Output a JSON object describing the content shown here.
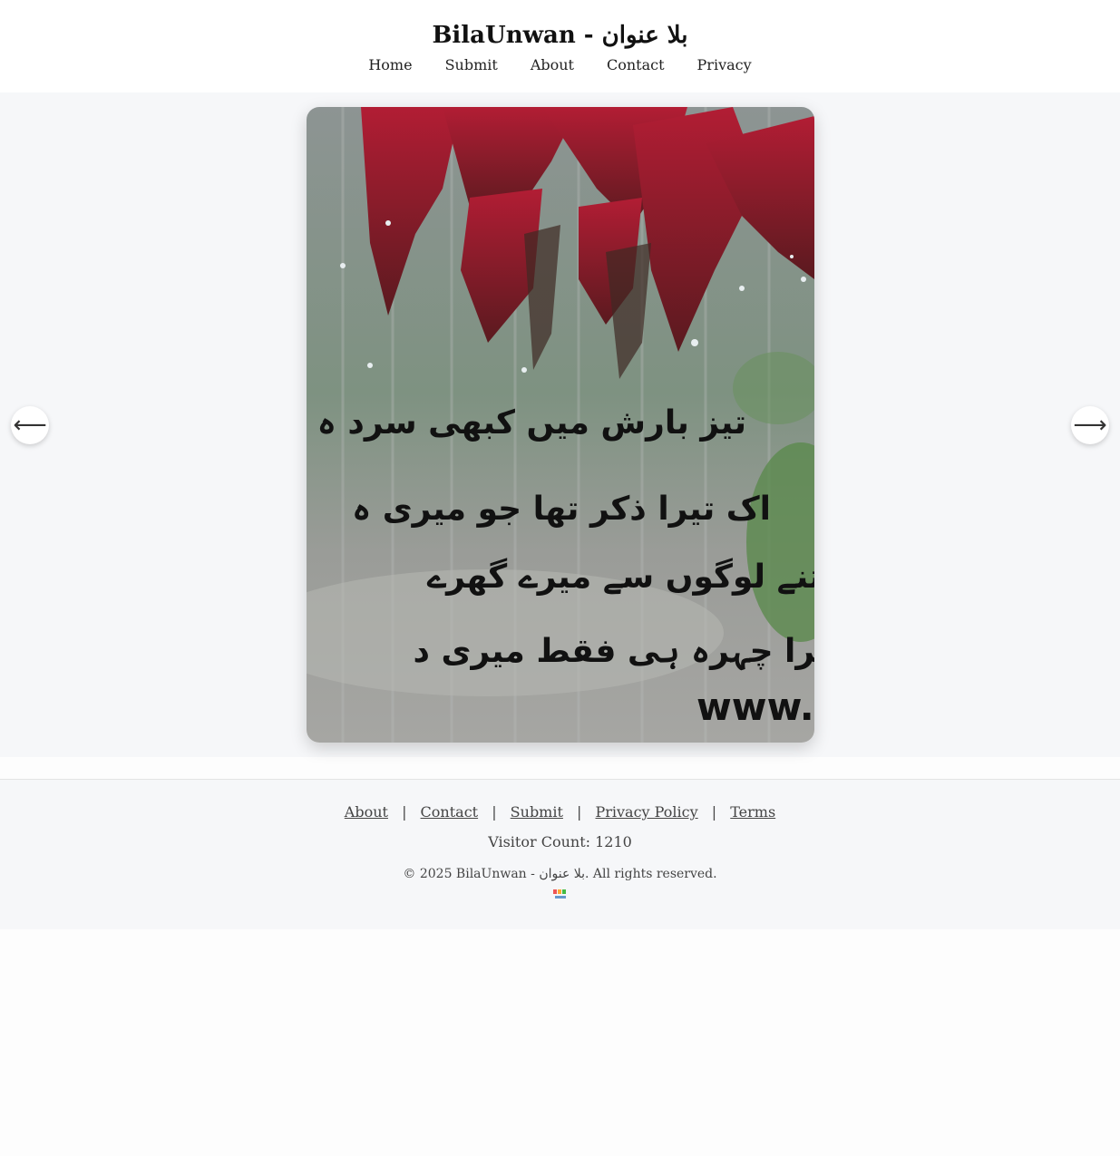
{
  "site": {
    "title": "BilaUnwan - بلا عنوان"
  },
  "nav": {
    "items": [
      {
        "label": "Home"
      },
      {
        "label": "Submit"
      },
      {
        "label": "About"
      },
      {
        "label": "Contact"
      },
      {
        "label": "Privacy"
      }
    ]
  },
  "slider": {
    "prev_label": "⟵",
    "next_label": "⟶",
    "image": {
      "poem_lines": [
        "تیز بارش میں کبھی سرد ہ",
        "اک تیرا ذکر تھا جو میری ہ",
        "کتنے لوگوں سے میرے گھرے",
        "تیرا چہرہ ہی فقط میری د"
      ],
      "watermark": "www."
    }
  },
  "footer": {
    "links": [
      {
        "label": "About"
      },
      {
        "label": "Contact"
      },
      {
        "label": "Submit"
      },
      {
        "label": "Privacy Policy"
      },
      {
        "label": "Terms"
      }
    ],
    "separator": "|",
    "visitor_count": "Visitor Count: 1210",
    "copyright": "© 2025 BilaUnwan - بلا عنوان. All rights reserved."
  }
}
